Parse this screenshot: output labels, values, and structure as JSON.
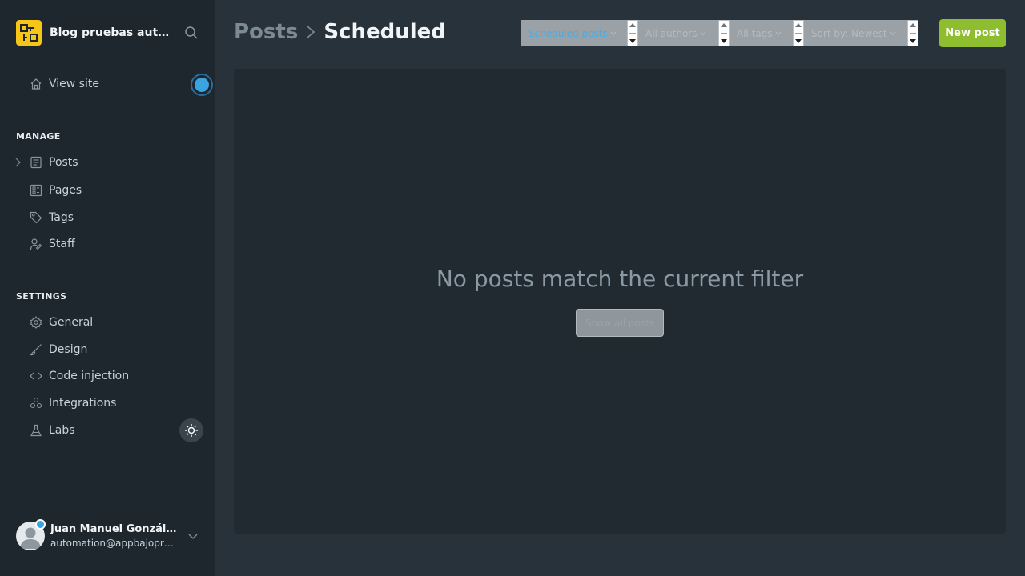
{
  "sidebar": {
    "brand": {
      "name": "Blog pruebas auto...",
      "logo_icon": "ghost-logo-icon"
    },
    "search_icon": "search-icon",
    "view_site": {
      "label": "View site",
      "icon": "home-icon"
    },
    "manage": {
      "title": "MANAGE",
      "items": [
        {
          "label": "Posts",
          "icon": "posts-icon"
        },
        {
          "label": "Pages",
          "icon": "pages-icon"
        },
        {
          "label": "Tags",
          "icon": "tag-icon"
        },
        {
          "label": "Staff",
          "icon": "staff-icon"
        }
      ]
    },
    "settings": {
      "title": "SETTINGS",
      "items": [
        {
          "label": "General",
          "icon": "gear-icon"
        },
        {
          "label": "Design",
          "icon": "brush-icon"
        },
        {
          "label": "Code injection",
          "icon": "code-icon"
        },
        {
          "label": "Integrations",
          "icon": "integrations-icon"
        },
        {
          "label": "Labs",
          "icon": "flask-icon"
        }
      ]
    },
    "user": {
      "name": "Juan Manuel Gonzále...",
      "email": "automation@appbajopru..."
    }
  },
  "header": {
    "breadcrumb_parent": "Posts",
    "breadcrumb_current": "Scheduled",
    "filters": {
      "type": "Scheduled posts",
      "author": "All authors",
      "tag": "All tags",
      "sort": "Sort by: Newest"
    },
    "new_post_label": "New post"
  },
  "main": {
    "empty_message": "No posts match the current filter",
    "empty_button_label": "Show all posts"
  },
  "colors": {
    "accent_green": "#8ebd2f",
    "brand_yellow": "#f5c518",
    "status_blue": "#3ba3e0",
    "active_filter_text": "#3eb0ef"
  }
}
